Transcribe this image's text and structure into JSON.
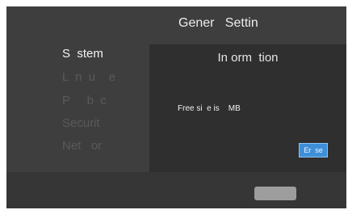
{
  "header": {
    "title": "Gener   Settin"
  },
  "sidebar": {
    "items": [
      {
        "label": "S  stem"
      },
      {
        "label": "L  n  u    e"
      },
      {
        "label": "P     b  c"
      },
      {
        "label": "Securit"
      },
      {
        "label": "Net   or"
      }
    ]
  },
  "panel": {
    "title": "In orm  tion",
    "text": "Free si  e is    MB",
    "erase_label": "Er  se"
  },
  "footer": {
    "button_label": ""
  }
}
